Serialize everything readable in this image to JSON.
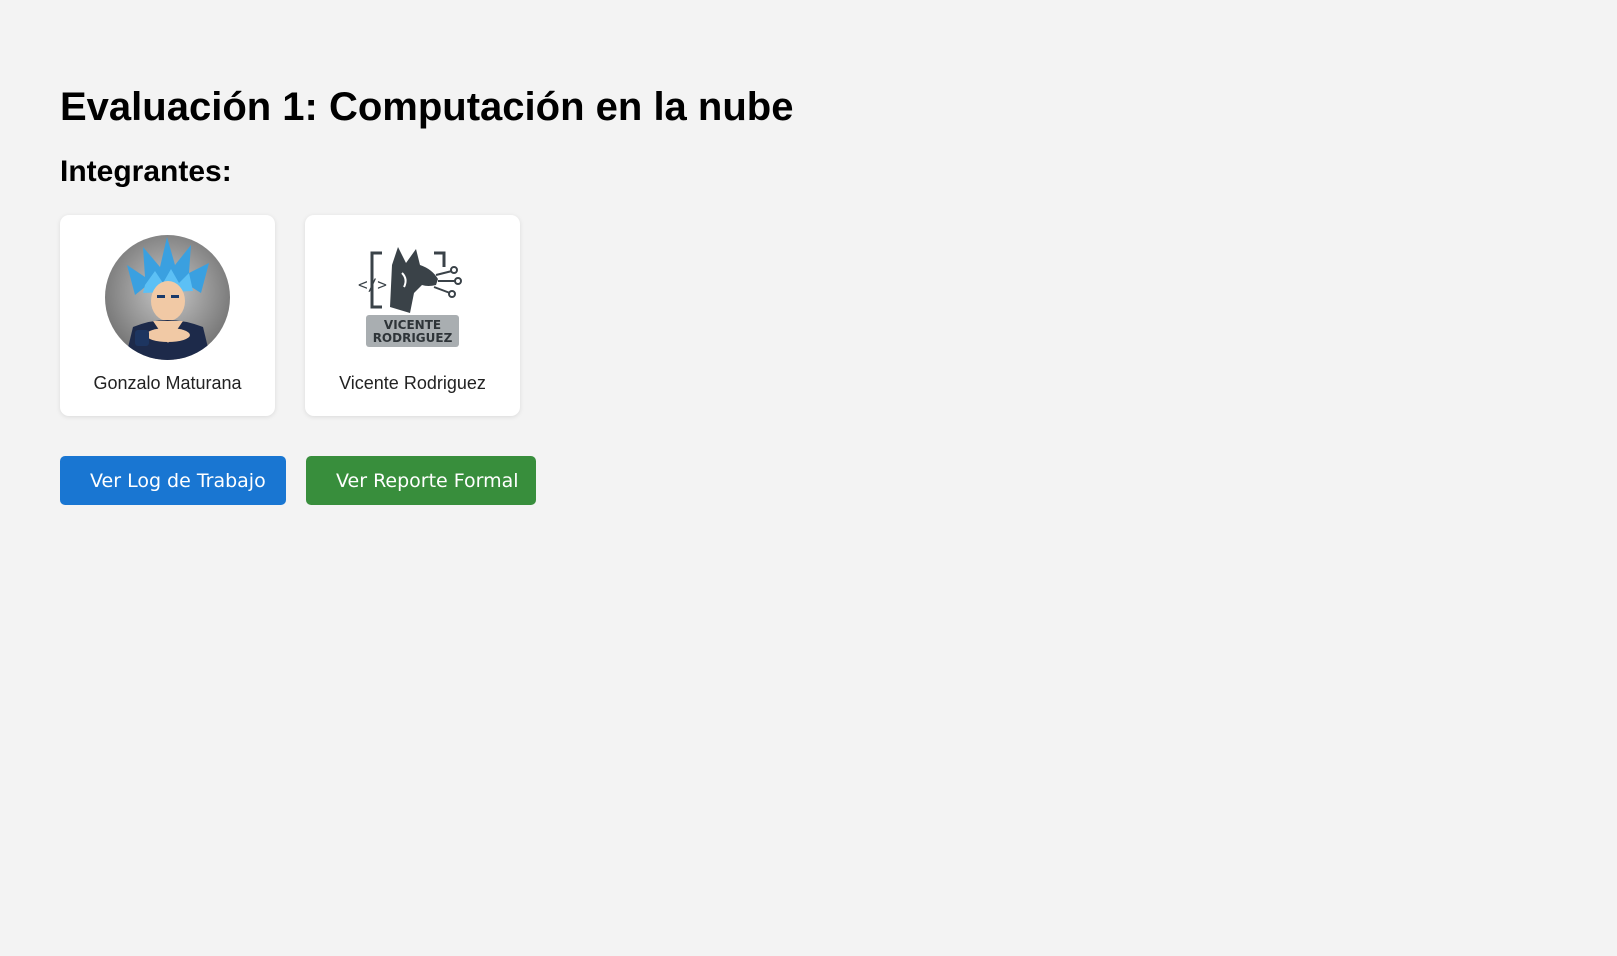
{
  "page": {
    "title": "Evaluación 1: Computación en la nube",
    "members_heading": "Integrantes:"
  },
  "members": [
    {
      "name": "Gonzalo Maturana",
      "avatar_icon": "anime-character-avatar-icon"
    },
    {
      "name": "Vicente Rodriguez",
      "avatar_icon": "dog-code-logo-icon",
      "logo_text": [
        "VICENTE",
        "RODRIGUEZ"
      ]
    }
  ],
  "actions": {
    "log_label": "Ver Log de Trabajo",
    "report_label": "Ver Reporte Formal"
  },
  "colors": {
    "background": "#f3f3f3",
    "log_button": "#1976d2",
    "report_button": "#388e3c",
    "card": "#ffffff"
  }
}
